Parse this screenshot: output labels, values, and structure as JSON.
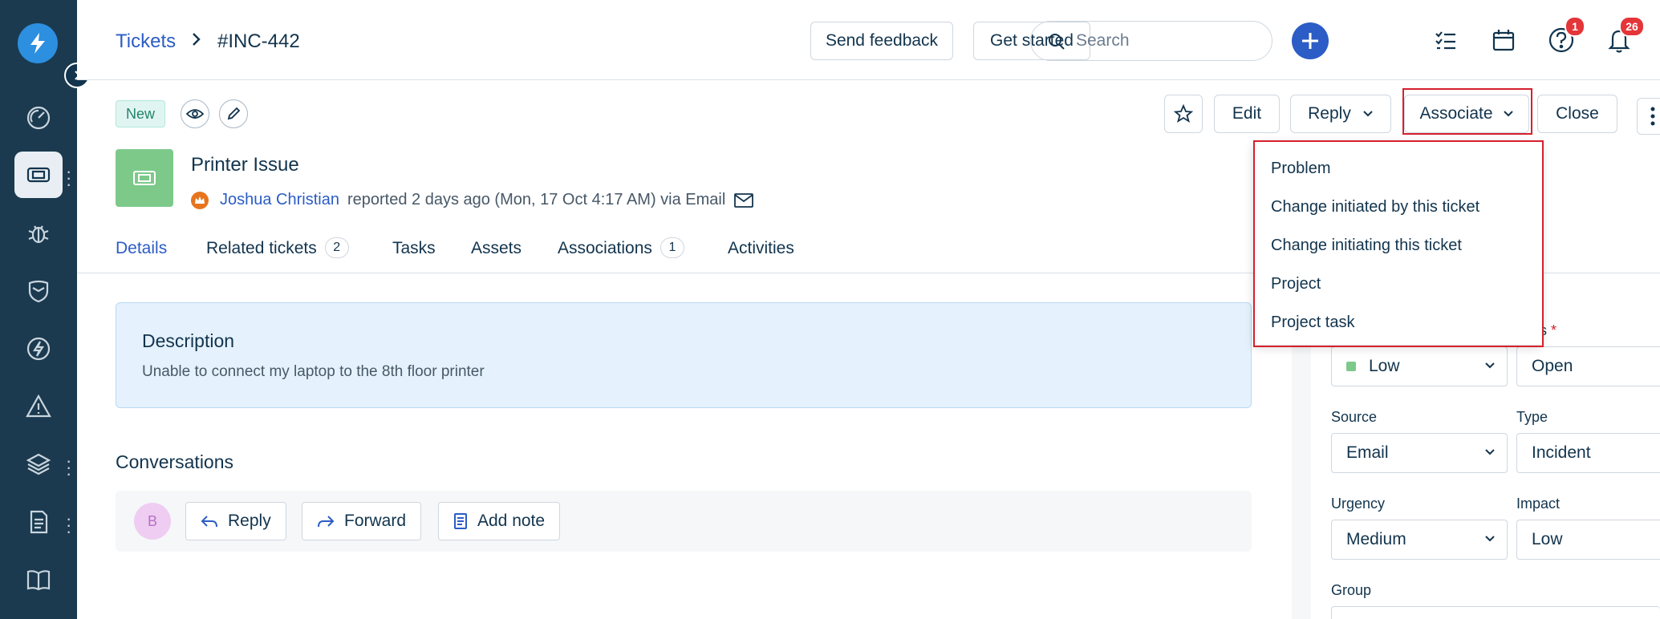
{
  "breadcrumb": {
    "tickets": "Tickets",
    "ticket_id": "#INC-442"
  },
  "topbar": {
    "send_feedback": "Send feedback",
    "get_started": "Get started",
    "search_placeholder": "Search",
    "help_badge": "1",
    "notif_badge": "26"
  },
  "ticket": {
    "status_tag": "New",
    "title": "Printer Issue",
    "reporter": "Joshua Christian",
    "reported_text": "reported 2 days ago (Mon, 17 Oct 4:17 AM) via Email"
  },
  "actions": {
    "edit": "Edit",
    "reply": "Reply",
    "associate": "Associate",
    "close": "Close"
  },
  "associate_menu": [
    "Problem",
    "Change initiated by this ticket",
    "Change initiating this ticket",
    "Project",
    "Project task"
  ],
  "tabs": {
    "details": "Details",
    "related": "Related tickets",
    "related_count": "2",
    "tasks": "Tasks",
    "assets": "Assets",
    "associations": "Associations",
    "associations_count": "1",
    "activities": "Activities"
  },
  "description": {
    "title": "Description",
    "text": "Unable to connect my laptop to the 8th floor printer"
  },
  "conversations": {
    "title": "Conversations",
    "avatar_initial": "B",
    "reply": "Reply",
    "forward": "Forward",
    "add_note": "Add note"
  },
  "properties": {
    "status_label_partial": "tus",
    "required_mark": "*",
    "priority_value": "Low",
    "status_value": "Open",
    "source_label": "Source",
    "source_value": "Email",
    "type_label": "Type",
    "type_value": "Incident",
    "urgency_label": "Urgency",
    "urgency_value": "Medium",
    "impact_label": "Impact",
    "impact_value": "Low",
    "group_label": "Group"
  },
  "colors": {
    "sidebar": "#1b3a4f",
    "accent": "#2c5cc5",
    "highlight": "#d6202c",
    "badge": "#e43538"
  }
}
